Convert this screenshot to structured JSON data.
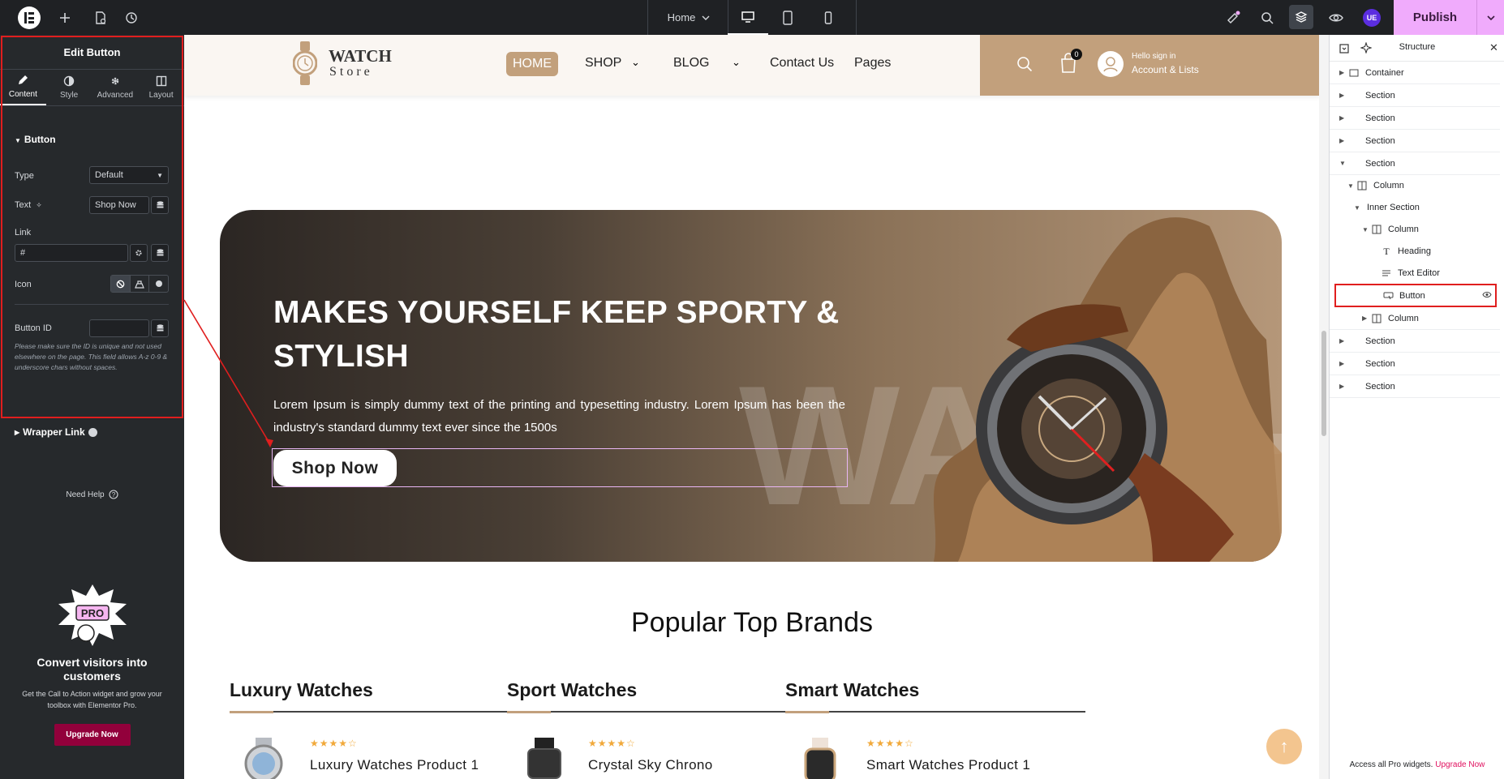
{
  "topbar": {
    "page_name": "Home",
    "publish_label": "Publish",
    "user_badge": "UE"
  },
  "left_panel": {
    "title": "Edit Button",
    "tabs": [
      {
        "label": "Content",
        "icon": "pencil-icon"
      },
      {
        "label": "Style",
        "icon": "half-circle-icon"
      },
      {
        "label": "Advanced",
        "icon": "gear-icon"
      },
      {
        "label": "Layout",
        "icon": "layout-icon"
      }
    ],
    "section_title": "Button",
    "type_label": "Type",
    "type_value": "Default",
    "text_label": "Text",
    "text_value": "Shop Now",
    "link_label": "Link",
    "link_value": "#",
    "icon_label": "Icon",
    "button_id_label": "Button ID",
    "button_id_value": "",
    "note": "Please make sure the ID is unique and not used elsewhere on the page. This field allows A-z  0-9 & underscore chars without spaces.",
    "wrapper_link": "Wrapper Link",
    "need_help": "Need Help",
    "promo_title": "Convert visitors into customers",
    "promo_text": "Get the Call to Action widget and grow your toolbox with Elementor Pro.",
    "promo_badge": "PRO",
    "upgrade_label": "Upgrade Now"
  },
  "site": {
    "logo_title": "WATCH",
    "logo_sub": "Store",
    "nav": [
      "HOME",
      "SHOP",
      "BLOG",
      "Contact Us",
      "Pages"
    ],
    "cart_count": "0",
    "account_line1": "Hello sign in",
    "account_line2": "Account & Lists",
    "hero_title": "MAKES YOURSELF KEEP SPORTY & STYLISH",
    "hero_text": "Lorem Ipsum is simply dummy text of the printing and typesetting industry. Lorem Ipsum has been the industry's standard dummy text ever since the 1500s",
    "hero_button": "Shop  Now",
    "hero_watermark": "WATCH",
    "popular_title": "Popular Top Brands",
    "brands": [
      {
        "title": "Luxury Watches",
        "product": "Luxury Watches Product 1",
        "stars": "★★★★☆"
      },
      {
        "title": "Sport Watches",
        "product": "Crystal Sky Chrono",
        "stars": "★★★★☆"
      },
      {
        "title": "Smart Watches",
        "product": "Smart Watches Product 1",
        "stars": "★★★★☆"
      }
    ]
  },
  "structure": {
    "title": "Structure",
    "rows": [
      {
        "label": "Container",
        "icon": "container-icon"
      },
      {
        "label": "Section",
        "icon": ""
      },
      {
        "label": "Section",
        "icon": ""
      },
      {
        "label": "Section",
        "icon": ""
      },
      {
        "label": "Section",
        "icon": ""
      },
      {
        "label": "Column",
        "icon": "column-icon"
      },
      {
        "label": "Inner Section",
        "icon": ""
      },
      {
        "label": "Column",
        "icon": "column-icon"
      },
      {
        "label": "Heading",
        "icon": "heading-icon"
      },
      {
        "label": "Text Editor",
        "icon": "text-editor-icon"
      },
      {
        "label": "Button",
        "icon": "button-icon"
      },
      {
        "label": "Column",
        "icon": "column-icon"
      },
      {
        "label": "Section",
        "icon": ""
      },
      {
        "label": "Section",
        "icon": ""
      },
      {
        "label": "Section",
        "icon": ""
      }
    ],
    "footer_text": "Access all Pro widgets.",
    "footer_link": "Upgrade Now"
  },
  "colors": {
    "accent_pink": "#f0abfc",
    "upgrade_red": "#92003b",
    "brand_tan": "#c2a07c",
    "highlight_red": "#e01e1e"
  }
}
